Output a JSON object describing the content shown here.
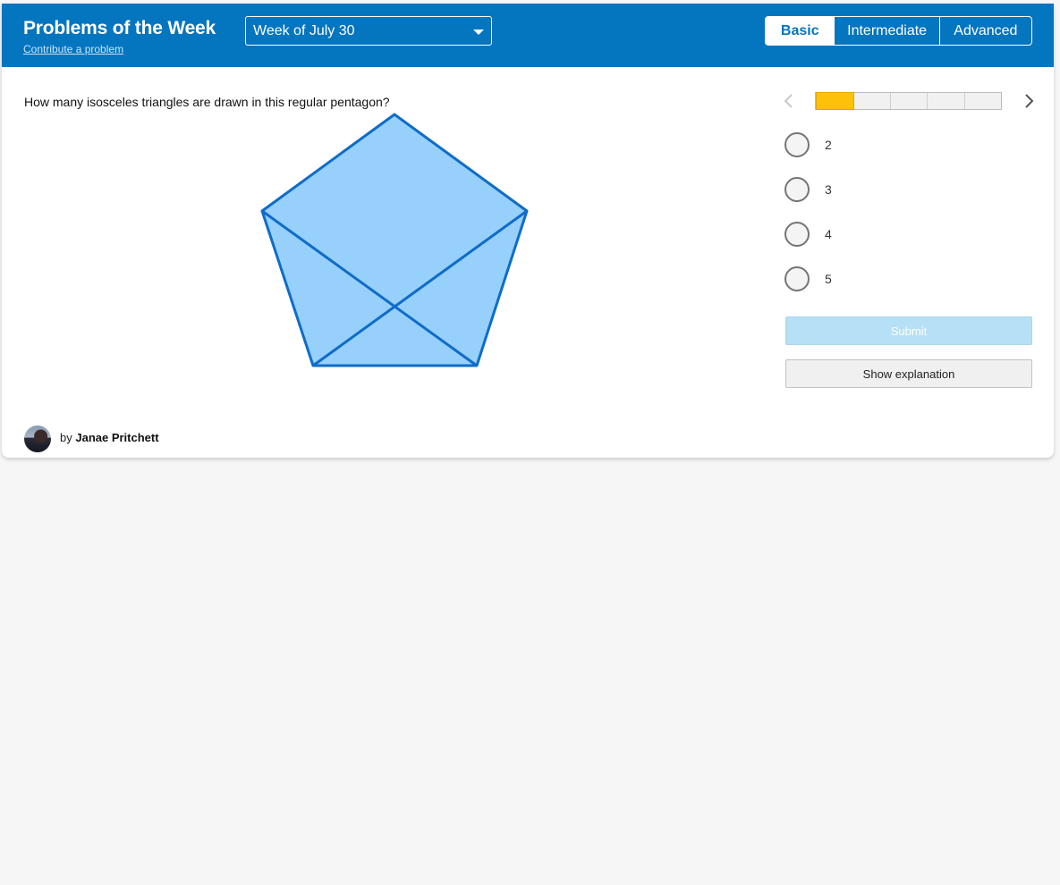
{
  "header": {
    "title": "Problems of the Week",
    "contribute_link": "Contribute a problem",
    "week_select": {
      "value": "Week of July 30"
    },
    "levels": [
      {
        "label": "Basic",
        "active": true
      },
      {
        "label": "Intermediate",
        "active": false
      },
      {
        "label": "Advanced",
        "active": false
      }
    ]
  },
  "problem": {
    "question": "How many isosceles triangles are drawn in this regular pentagon?"
  },
  "progress": {
    "total_segments": 5,
    "current_segment": 1,
    "fill_color": "#fec10a"
  },
  "choices": [
    {
      "label": "2"
    },
    {
      "label": "3"
    },
    {
      "label": "4"
    },
    {
      "label": "5"
    }
  ],
  "actions": {
    "submit_label": "Submit",
    "explanation_label": "Show explanation"
  },
  "author": {
    "by_prefix": "by",
    "name": "Janae Pritchett"
  },
  "colors": {
    "header_bg": "#0475bf",
    "figure_fill": "#96d0fb",
    "figure_stroke": "#0f6cc8",
    "submit_disabled": "#b6e0f6"
  },
  "icons": {
    "prev": "chevron-left-icon",
    "next": "chevron-right-icon",
    "dropdown": "caret-down-icon"
  }
}
